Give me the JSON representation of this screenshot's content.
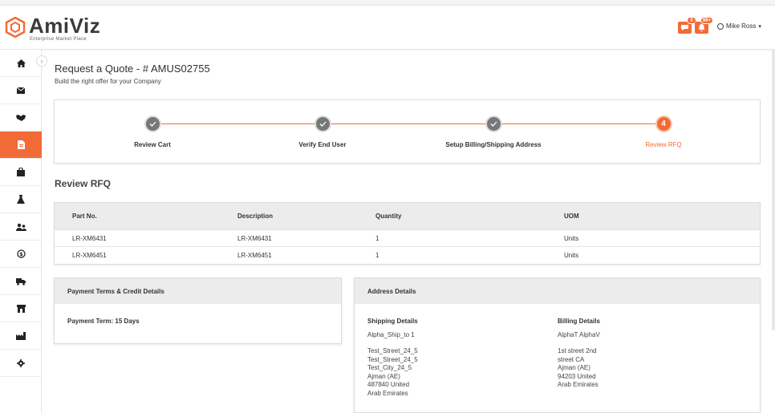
{
  "brand": {
    "name": "AmiViz",
    "tagline": "Enterprise Market Place",
    "accent": "#f26b37"
  },
  "header": {
    "notifications": [
      {
        "icon": "chat-icon",
        "badge": "0"
      },
      {
        "icon": "bell-icon",
        "badge": "99+"
      }
    ],
    "user_name": "Mike Ross",
    "user_caret": "▾"
  },
  "sidebar": {
    "items": [
      {
        "icon": "home-icon"
      },
      {
        "icon": "envelope-icon"
      },
      {
        "icon": "handshake-icon"
      },
      {
        "icon": "document-icon",
        "active": true
      },
      {
        "icon": "shopping-bag-icon"
      },
      {
        "icon": "flask-icon"
      },
      {
        "icon": "users-icon"
      },
      {
        "icon": "refresh-dollar-icon"
      },
      {
        "icon": "truck-icon"
      },
      {
        "icon": "store-icon"
      },
      {
        "icon": "industry-icon"
      },
      {
        "icon": "gear-icon"
      }
    ]
  },
  "page": {
    "title": "Request a Quote - # AMUS02755",
    "subtitle": "Build the right offer for your Company"
  },
  "stepper": {
    "steps": [
      {
        "label": "Review Cart",
        "state": "done"
      },
      {
        "label": "Verify End User",
        "state": "done"
      },
      {
        "label": "Setup Billing/Shipping Address",
        "state": "done"
      },
      {
        "label": "Review RFQ",
        "state": "current",
        "number": "4"
      }
    ]
  },
  "review": {
    "title": "Review RFQ",
    "columns": [
      "Part No.",
      "Description",
      "Quantity",
      "UOM"
    ],
    "rows": [
      [
        "LR-XM6431",
        "LR-XM6431",
        "1",
        "Units"
      ],
      [
        "LR-XM6451",
        "LR-XM6451",
        "1",
        "Units"
      ]
    ]
  },
  "payment": {
    "title": "Payment Terms & Credit Details",
    "term_label": "Payment Term: 15 Days"
  },
  "address": {
    "title": "Address Details",
    "shipping": {
      "label": "Shipping Details",
      "name": "Alpha_Ship_to 1",
      "lines": "Test_Street_24_5\nTest_Street_24_5\nTest_City_24_5\nAjman (AE)\n487840 United\nArab Emirates"
    },
    "billing": {
      "label": "Billing Details",
      "name": "AlphaT AlphaV",
      "lines": "1st street 2nd\nstreet CA\nAjman (AE)\n94203 United\nArab Emirates"
    }
  }
}
